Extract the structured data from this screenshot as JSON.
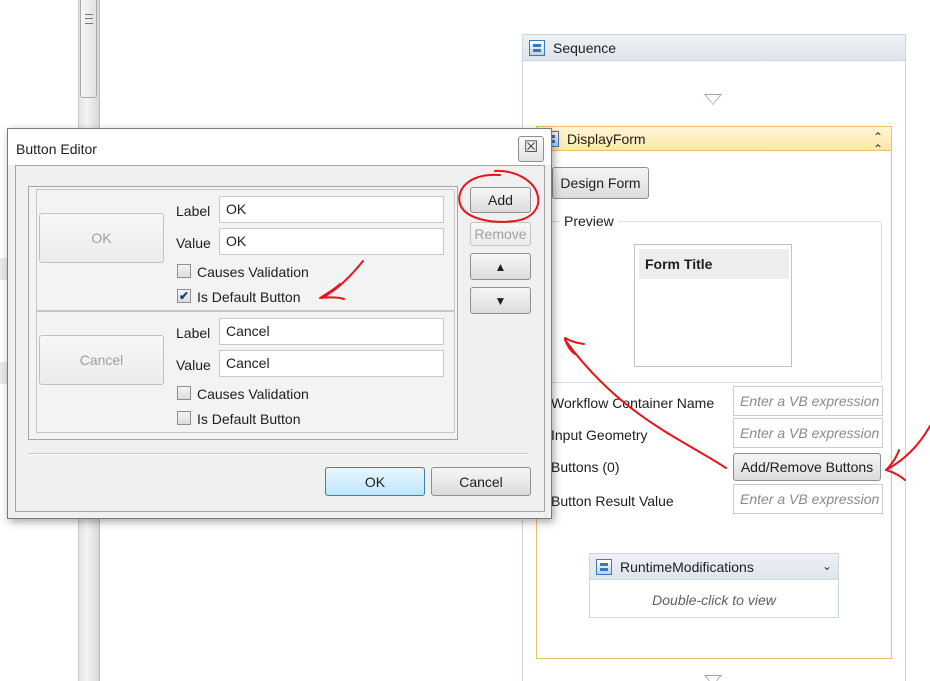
{
  "sequence": {
    "title": "Sequence"
  },
  "display_form": {
    "title": "DisplayForm",
    "design_form_label": "Design Form",
    "preview_label": "Preview",
    "preview_form_title": "Form Title",
    "properties": [
      {
        "label": "Workflow Container Name",
        "placeholder": "Enter a VB expression"
      },
      {
        "label": "Input Geometry",
        "placeholder": "Enter a VB expression"
      },
      {
        "label": "Buttons (0)",
        "action_label": "Add/Remove Buttons"
      },
      {
        "label": "Button Result Value",
        "placeholder": "Enter a VB expression"
      }
    ]
  },
  "runtime_modifications": {
    "title": "RuntimeModifications",
    "hint": "Double-click to view"
  },
  "button_editor": {
    "title": "Button Editor",
    "close_glyph": "☒",
    "buttons": [
      {
        "preview_label": "OK",
        "label_caption": "Label",
        "label_value": "OK",
        "value_caption": "Value",
        "value_value": "OK",
        "causes_validation_label": "Causes Validation",
        "causes_validation": false,
        "is_default_label": "Is Default Button",
        "is_default": true
      },
      {
        "preview_label": "Cancel",
        "label_caption": "Label",
        "label_value": "Cancel",
        "value_caption": "Value",
        "value_value": "Cancel",
        "causes_validation_label": "Causes Validation",
        "causes_validation": false,
        "is_default_label": "Is Default Button",
        "is_default": false
      }
    ],
    "add_label": "Add",
    "remove_label": "Remove",
    "move_up_glyph": "▲",
    "move_down_glyph": "▼",
    "ok_label": "OK",
    "cancel_label": "Cancel",
    "checkmark_glyph": "✔"
  },
  "colors": {
    "annotation": "#e8141c",
    "display_form_border": "#e6c36e",
    "primary_button": "#bee6fd"
  }
}
